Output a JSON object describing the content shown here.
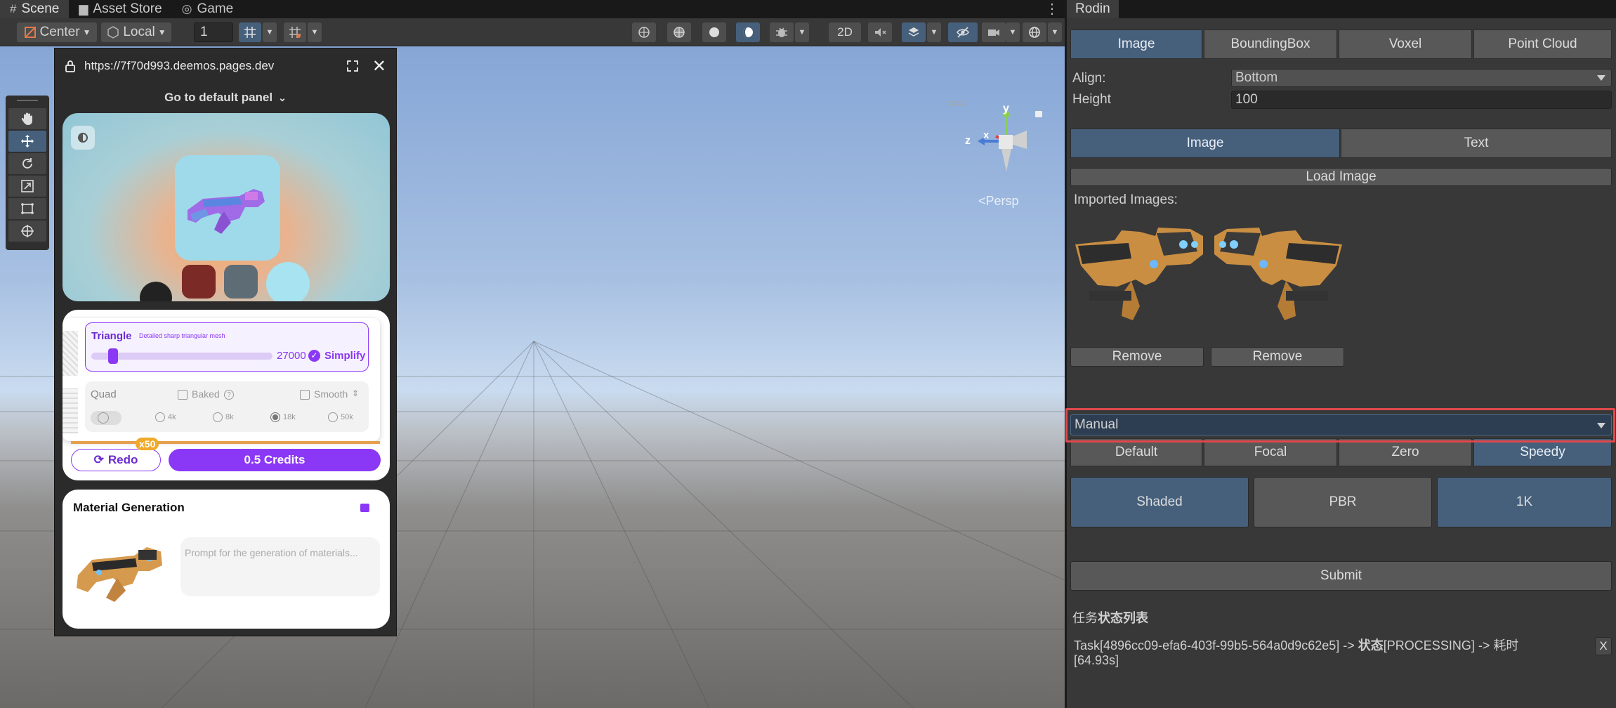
{
  "tabs": {
    "scene": "Scene",
    "asset_store": "Asset Store",
    "game": "Game"
  },
  "toolbar": {
    "pivot": "Center",
    "space": "Local",
    "grid_value": "1",
    "mode_2d": "2D"
  },
  "scene": {
    "camera_label": "Persp",
    "axis_x": "x",
    "axis_y": "y",
    "axis_z": "z"
  },
  "web": {
    "url": "https://7f70d993.deemos.pages.dev",
    "default_panel": "Go to default panel",
    "triangle": {
      "title": "Triangle",
      "desc": "Detailed sharp triangular mesh",
      "value": "27000",
      "simplify": "Simplify"
    },
    "quad": {
      "title": "Quad",
      "baked": "Baked",
      "smooth": "Smooth",
      "options": [
        "4k",
        "8k",
        "18k",
        "50k"
      ],
      "selected": "18k"
    },
    "redo": "Redo",
    "redo_badge": "x50",
    "credits": "0.5 Credits",
    "material_title": "Material Generation",
    "material_placeholder": "Prompt for the generation of materials..."
  },
  "inspector": {
    "title": "Rodin",
    "modes": [
      "Image",
      "BoundingBox",
      "Voxel",
      "Point Cloud"
    ],
    "active_mode": "Image",
    "align_label": "Align:",
    "align_value": "Bottom",
    "height_label": "Height",
    "height_value": "100",
    "input_tabs": [
      "Image",
      "Text"
    ],
    "load_image": "Load Image",
    "imported_label": "Imported Images:",
    "remove": "Remove",
    "mode_select": "Manual",
    "quality_tabs": [
      "Default",
      "Focal",
      "Zero",
      "Speedy"
    ],
    "active_quality": "Speedy",
    "material_buttons": [
      "Shaded",
      "PBR",
      "1K"
    ],
    "submit": "Submit",
    "task_list_prefix": "任务",
    "task_list_bold": "状态列表",
    "task_text_a": "Task[4896cc09-efa6-403f-99b5-564a0d9c62e5] -> ",
    "task_state_label": "状态",
    "task_text_b": "[PROCESSING] -> 耗时",
    "task_time": "[64.93s]",
    "task_close": "X"
  },
  "colors": {
    "accent_blue": "#46607c",
    "purple": "#8a38f5",
    "highlight_red": "#e0484c"
  }
}
